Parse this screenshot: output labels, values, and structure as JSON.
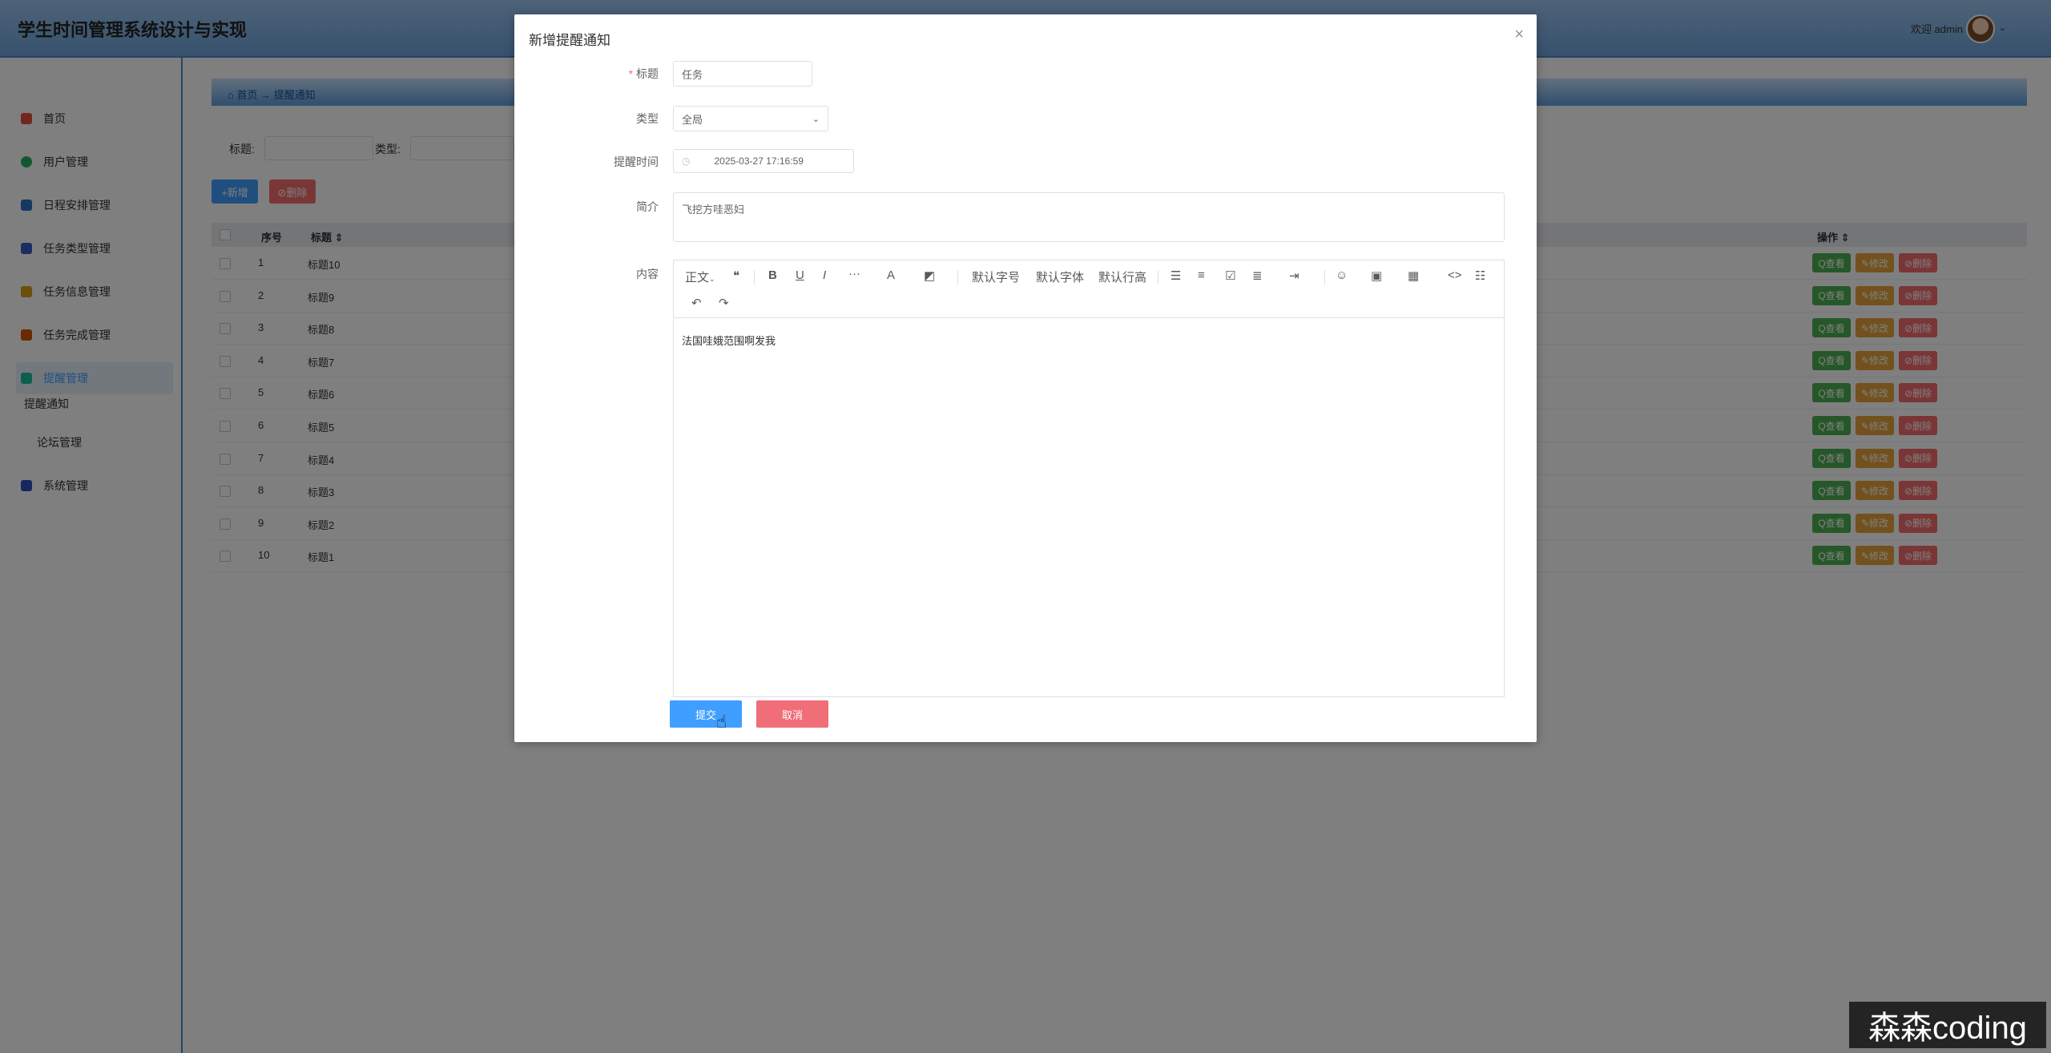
{
  "app": {
    "title": "学生时间管理系统设计与实现",
    "welcome": "欢迎 admin",
    "caret": "⌄"
  },
  "sidebar": {
    "items": [
      {
        "label": "首页",
        "color": "#e74c3c"
      },
      {
        "label": "用户管理",
        "color": "#27ae60"
      },
      {
        "label": "日程安排管理",
        "color": "#2d73c6"
      },
      {
        "label": "任务类型管理",
        "color": "#3a5bbf"
      },
      {
        "label": "任务信息管理",
        "color": "#d4a017"
      },
      {
        "label": "任务完成管理",
        "color": "#d35400"
      },
      {
        "label": "提醒管理",
        "color": "#1abc9c"
      }
    ],
    "sub_items": [
      "提醒通知",
      "论坛管理"
    ],
    "last_item": {
      "label": "系统管理",
      "color": "#2c4ec9"
    }
  },
  "breadcrumb": {
    "home": "首页",
    "sep": "→",
    "current": "提醒通知"
  },
  "filters": {
    "title_label": "标题:",
    "type_label": "类型:"
  },
  "toolbar": {
    "add_label": "+新增",
    "delete_label": "⊘删除"
  },
  "table": {
    "headers": {
      "index": "序号",
      "title": "标题 ⇕",
      "ops": "操作 ⇕"
    },
    "rows": [
      {
        "index": "1",
        "title": "标题10"
      },
      {
        "index": "2",
        "title": "标题9"
      },
      {
        "index": "3",
        "title": "标题8"
      },
      {
        "index": "4",
        "title": "标题7"
      },
      {
        "index": "5",
        "title": "标题6"
      },
      {
        "index": "6",
        "title": "标题5"
      },
      {
        "index": "7",
        "title": "标题4"
      },
      {
        "index": "8",
        "title": "标题3"
      },
      {
        "index": "9",
        "title": "标题2"
      },
      {
        "index": "10",
        "title": "标题1"
      }
    ],
    "actions": {
      "view": "Q查看",
      "edit": "✎修改",
      "delete": "⊘删除"
    }
  },
  "dialog": {
    "title": "新增提醒通知",
    "close": "×",
    "fields": {
      "title_label": "标题",
      "title_value": "任务",
      "type_label": "类型",
      "type_value": "全局",
      "time_label": "提醒时间",
      "time_value": "2025-03-27 17:16:59",
      "intro_label": "简介",
      "intro_value": "飞挖方哇恶妇",
      "content_label": "内容",
      "content_value": "法国哇娥范围啊发我"
    },
    "editor_toolbar": {
      "paragraph": "正文",
      "font_size": "默认字号",
      "font_family": "默认字体",
      "line_height": "默认行高"
    },
    "submit": "提交",
    "cancel": "取消"
  },
  "watermark": "森森coding"
}
